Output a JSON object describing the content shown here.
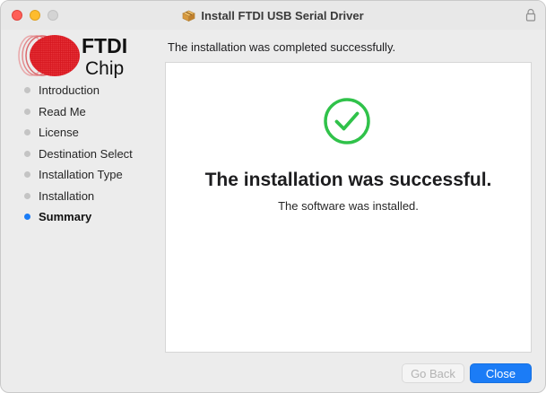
{
  "window": {
    "title": "Install FTDI USB Serial Driver"
  },
  "logo": {
    "line1": "FTDI",
    "line2": "Chip"
  },
  "sidebar": {
    "steps": [
      {
        "label": "Introduction",
        "active": false
      },
      {
        "label": "Read Me",
        "active": false
      },
      {
        "label": "License",
        "active": false
      },
      {
        "label": "Destination Select",
        "active": false
      },
      {
        "label": "Installation Type",
        "active": false
      },
      {
        "label": "Installation",
        "active": false
      },
      {
        "label": "Summary",
        "active": true
      }
    ]
  },
  "main": {
    "message": "The installation was completed successfully.",
    "headline": "The installation was successful.",
    "subline": "The software was installed.",
    "status_icon": "success-check-icon"
  },
  "buttons": {
    "back_label": "Go Back",
    "back_enabled": false,
    "close_label": "Close"
  },
  "colors": {
    "accent": "#1b7cf6",
    "success": "#30c24a",
    "logo_red": "#d6161e"
  }
}
